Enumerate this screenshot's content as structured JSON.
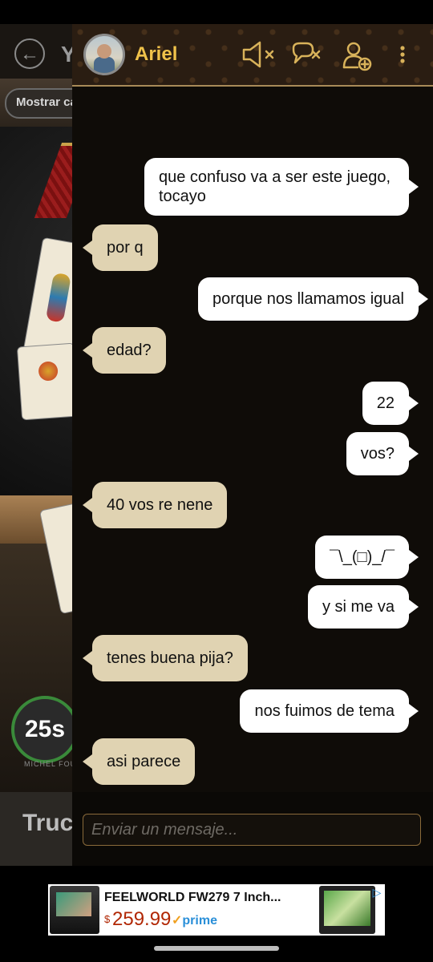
{
  "game": {
    "back_icon": "arrow-left-icon",
    "title_fragment": "Y",
    "show_cards_button": "Mostrar ca",
    "timer": "25s",
    "player_label": "MICHEL FOUCH",
    "bottom_text": "Truc"
  },
  "chat": {
    "contact_name": "Ariel",
    "icons": [
      "mute-icon",
      "mute-chat-icon",
      "add-friend-icon",
      "more-vertical-icon"
    ],
    "messages": [
      {
        "from": "me",
        "text": "que confuso va a ser este juego, tocayo"
      },
      {
        "from": "them",
        "text": "por q"
      },
      {
        "from": "me",
        "text": "porque nos llamamos igual"
      },
      {
        "from": "them",
        "text": "edad?"
      },
      {
        "from": "me",
        "text": "22"
      },
      {
        "from": "me",
        "text": "vos?"
      },
      {
        "from": "them",
        "text": "40 vos re nene"
      },
      {
        "from": "me",
        "text": "¯\\_(□)_/¯"
      },
      {
        "from": "me",
        "text": "y si me va"
      },
      {
        "from": "them",
        "text": "tenes buena pija?"
      },
      {
        "from": "me",
        "text": "nos fuimos de tema"
      },
      {
        "from": "them",
        "text": "asi parece"
      }
    ],
    "input_placeholder": "Enviar un mensaje..."
  },
  "ad": {
    "title": "FEELWORLD FW279 7 Inch...",
    "price_symbol": "$",
    "price": "259.99",
    "prime_check": "✓",
    "prime_label": "prime",
    "info_icon": "ad-info-icon"
  },
  "colors": {
    "contact_name": "#f0c24a",
    "incoming_bubble": "#e0d3b2",
    "outgoing_bubble": "#ffffff",
    "header_border": "#a88a58",
    "price": "#b12704",
    "prime": "#2a8fd8"
  }
}
